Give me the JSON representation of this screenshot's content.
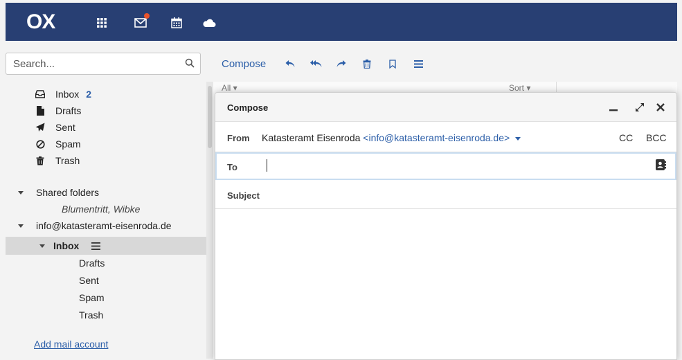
{
  "app": {
    "logo_text": "OX"
  },
  "topbar": {
    "icons": [
      "apps-grid-icon",
      "mail-icon",
      "calendar-icon",
      "cloud-icon"
    ],
    "colors": {
      "background": "#283f73",
      "notification": "#e8532b"
    }
  },
  "search": {
    "placeholder": "Search..."
  },
  "folders": {
    "standard": [
      {
        "label": "Inbox",
        "icon": "inbox-icon",
        "badge": "2"
      },
      {
        "label": "Drafts",
        "icon": "file-icon"
      },
      {
        "label": "Sent",
        "icon": "paper-plane-icon"
      },
      {
        "label": "Spam",
        "icon": "ban-icon"
      },
      {
        "label": "Trash",
        "icon": "trash-icon"
      }
    ],
    "shared": {
      "label": "Shared folders",
      "children": [
        "Blumentritt, Wibke"
      ]
    },
    "account": {
      "label": "info@katasteramt-eisenroda.de",
      "inbox_label": "Inbox",
      "children": [
        "Drafts",
        "Sent",
        "Spam",
        "Trash"
      ]
    },
    "add_account_label": "Add mail account"
  },
  "toolbar": {
    "compose_label": "Compose",
    "icons": [
      "reply-icon",
      "reply-all-icon",
      "forward-icon",
      "delete-icon",
      "bookmark-icon",
      "menu-icon"
    ]
  },
  "list": {
    "filter_label": "All",
    "sort_label": "Sort"
  },
  "compose": {
    "title": "Compose",
    "from_label": "From",
    "from_name": "Katasteramt Eisenroda",
    "from_address": "<info@katasteramt-eisenroda.de>",
    "cc_label": "CC",
    "bcc_label": "BCC",
    "to_label": "To",
    "to_value": "",
    "subject_label": "Subject",
    "subject_value": ""
  },
  "colors": {
    "accent": "#2b5ea8"
  }
}
